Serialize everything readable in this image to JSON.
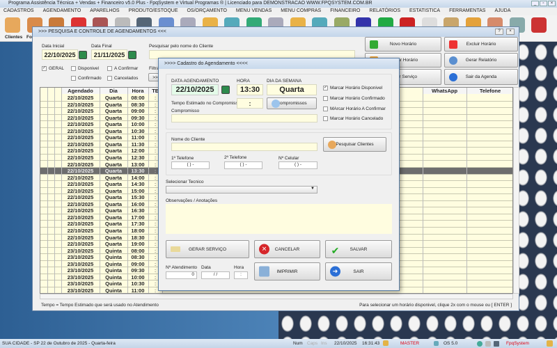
{
  "window": {
    "title": "Programa Assistência Técnica + Vendas + Financeiro v5.0 Plus - FpqSystem e Virtual Programas ® | Licenciado para  DEMONSTRACAO WWW.FPQSYSTEM.COM.BR"
  },
  "menu": [
    "CADASTROS",
    "AGENDAMENTO",
    "APARELHOS",
    "PRODUTO/ESTOQUE",
    "OS/ORÇAMENTO",
    "MENU VENDAS",
    "MENU COMPRAS",
    "FINANCEIRO",
    "RELATÓRIOS",
    "ESTATISTICA",
    "FERRAMENTAS",
    "AJUDA"
  ],
  "toolbar": {
    "labels": [
      "Clientes",
      "Fo"
    ]
  },
  "child": {
    "title": ">>>  PESQUISA E CONTROLE DE AGENDAMENTOS  <<<",
    "data_inicial_label": "Data Inicial",
    "data_inicial": "22/10/2025",
    "data_final_label": "Data Final",
    "data_final": "21/11/2025",
    "search_label": "Pesquisar pelo nome do Cliente",
    "search_value": "",
    "filters": {
      "geral": "GERAL",
      "disponivel": "Disponivel",
      "a_confirmar": "A Confirmar",
      "confirmado": "Confirmado",
      "cancelados": "Cancelados"
    },
    "filtrar_label": "Filtrar",
    "filtrar_btn": ">>",
    "buttons": {
      "novo": "Novo Horário",
      "excluir": "Excluir Horário",
      "alterar": "Alterar Horário",
      "relatorio": "Gerar Relatório",
      "servico": "Gerar  Serviço",
      "sair": "Sair da Agenda"
    },
    "columns": {
      "agendado": "Agendado",
      "dia": "Dia",
      "hora": "Hora",
      "te": "TE",
      "whatsapp": "WhatsApp",
      "telefone": "Telefone"
    },
    "rows": [
      [
        "22/10/2025",
        "Quarta",
        "08:00",
        ":"
      ],
      [
        "22/10/2025",
        "Quarta",
        "08:30",
        ":"
      ],
      [
        "22/10/2025",
        "Quarta",
        "09:00",
        ":"
      ],
      [
        "22/10/2025",
        "Quarta",
        "09:30",
        ":"
      ],
      [
        "22/10/2025",
        "Quarta",
        "10:00",
        ":"
      ],
      [
        "22/10/2025",
        "Quarta",
        "10:30",
        ":"
      ],
      [
        "22/10/2025",
        "Quarta",
        "11:00",
        ":"
      ],
      [
        "22/10/2025",
        "Quarta",
        "11:30",
        ":"
      ],
      [
        "22/10/2025",
        "Quarta",
        "12:00",
        ":"
      ],
      [
        "22/10/2025",
        "Quarta",
        "12:30",
        ":"
      ],
      [
        "22/10/2025",
        "Quarta",
        "13:00",
        ":"
      ],
      [
        "22/10/2025",
        "Quarta",
        "13:30",
        ":"
      ],
      [
        "22/10/2025",
        "Quarta",
        "14:00",
        ":"
      ],
      [
        "22/10/2025",
        "Quarta",
        "14:30",
        ":"
      ],
      [
        "22/10/2025",
        "Quarta",
        "15:00",
        ":"
      ],
      [
        "22/10/2025",
        "Quarta",
        "15:30",
        ":"
      ],
      [
        "22/10/2025",
        "Quarta",
        "16:00",
        ":"
      ],
      [
        "22/10/2025",
        "Quarta",
        "16:30",
        ":"
      ],
      [
        "22/10/2025",
        "Quarta",
        "17:00",
        ":"
      ],
      [
        "22/10/2025",
        "Quarta",
        "17:30",
        ":"
      ],
      [
        "22/10/2025",
        "Quarta",
        "18:00",
        ":"
      ],
      [
        "22/10/2025",
        "Quarta",
        "18:30",
        ":"
      ],
      [
        "22/10/2025",
        "Quarta",
        "19:00",
        ":"
      ],
      [
        "23/10/2025",
        "Quinta",
        "08:00",
        ":"
      ],
      [
        "23/10/2025",
        "Quinta",
        "08:30",
        ":"
      ],
      [
        "23/10/2025",
        "Quinta",
        "09:00",
        ":"
      ],
      [
        "23/10/2025",
        "Quinta",
        "09:30",
        ":"
      ],
      [
        "23/10/2025",
        "Quinta",
        "10:00",
        ":"
      ],
      [
        "23/10/2025",
        "Quinta",
        "10:30",
        ":"
      ],
      [
        "23/10/2025",
        "Quinta",
        "11:00",
        ":"
      ]
    ],
    "selected_row": 11,
    "footer_left": "Tempo = Tempo Estimado que será usado no Atendimento",
    "footer_right": "Para selecionar um horário disponivel, clique 2x com o mouse ou [ ENTER ]"
  },
  "dialog": {
    "title": ">>>>   Cadastro do Agendamento   <<<<",
    "data_label": "DATA AGENDAMENTO",
    "data": "22/10/2025",
    "hora_label": "HORA",
    "hora": "13:30",
    "dia_label": "DIA DA SEMANA",
    "dia": "Quarta",
    "tempo_label": "Tempo Estimado no Compromisso",
    "tempo": ":",
    "compromissos_btn": "Compromissos",
    "compromisso_label": "Compromisso",
    "checks": {
      "disponivel": "Marcar Horário Disponivel",
      "confirmado": "Marcar Horário Confirmado",
      "a_confirmar": "MArcar Horário A Confirmar",
      "cancelado": "Marcar Horário Cancelado"
    },
    "cliente_label": "Nome do Cliente",
    "pesquisar_btn": "Pesquisar Clientes",
    "tel1_label": "1º Telefone",
    "tel2_label": "2º Telefone",
    "cel_label": "Nº Celular",
    "phone_mask": "(  )     -",
    "tecnico_label": "Selecionar Tecnico",
    "obs_label": "Observações  / Anotações",
    "gerar_btn": "GERAR  SERVIÇO",
    "cancelar_btn": "CANCELAR",
    "salvar_btn": "SALVAR",
    "imprimir_btn": "IMPRIMIR",
    "sair_btn": "SAIR",
    "atendimento_label": "Nº Atendimento",
    "atendimento": "0",
    "data2_label": "Data",
    "data2": "/  /",
    "hora2_label": "Hora",
    "hora2": ":"
  },
  "status": {
    "city": "SUA CIDADE - SP 22 de Outubro de 2025 - Quarta-feira",
    "num": "Num",
    "caps": "Caps",
    "ins": "Ins",
    "date": "22/10/2025",
    "time": "16:31:43",
    "user": "MASTER",
    "os": "OS 5.0",
    "brand": "FpqSystem"
  }
}
